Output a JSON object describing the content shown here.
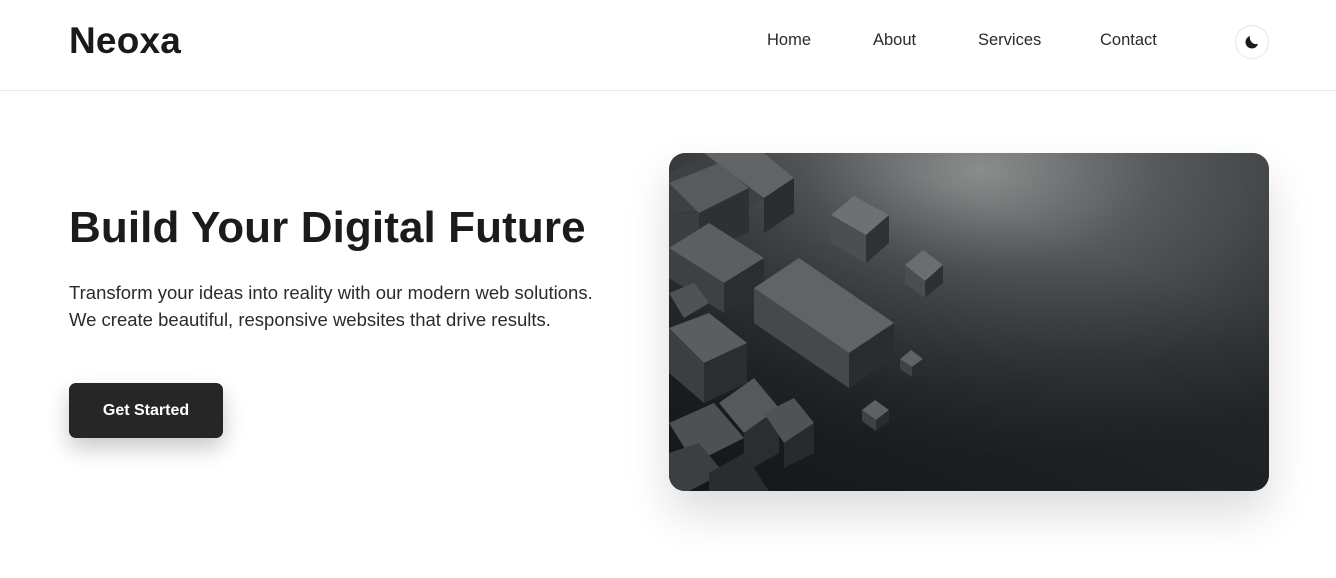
{
  "brand": {
    "name": "Neoxa"
  },
  "nav": {
    "items": [
      {
        "label": "Home"
      },
      {
        "label": "About"
      },
      {
        "label": "Services"
      },
      {
        "label": "Contact"
      }
    ],
    "theme_toggle_icon": "moon-icon"
  },
  "hero": {
    "title": "Build Your Digital Future",
    "description": "Transform your ideas into reality with our modern web solutions. We create beautiful, responsive websites that drive results.",
    "cta_label": "Get Started",
    "image_icon": "abstract-cubes-image"
  },
  "colors": {
    "text": "#1b1b1b",
    "button_bg": "#262626",
    "button_text": "#ffffff",
    "border": "#e8e8e8"
  }
}
